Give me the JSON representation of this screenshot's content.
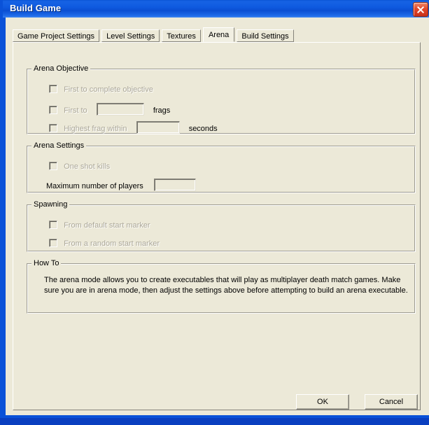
{
  "window": {
    "title": "Build Game",
    "close_icon": "close-icon",
    "accent_color": "#0a52d8",
    "face_color": "#ece9d8"
  },
  "tabs": [
    {
      "label": "Game Project Settings",
      "selected": false
    },
    {
      "label": "Level Settings",
      "selected": false
    },
    {
      "label": "Textures",
      "selected": false
    },
    {
      "label": "Arena",
      "selected": true
    },
    {
      "label": "Build Settings",
      "selected": false
    }
  ],
  "groups": {
    "arena_objective": {
      "title": "Arena Objective",
      "rows": [
        {
          "checkbox_label": "First to complete objective",
          "checked": false,
          "enabled": false
        },
        {
          "checkbox_label": "First to",
          "checked": false,
          "enabled": false,
          "field_value": "",
          "unit_label": "frags"
        },
        {
          "checkbox_label": "Highest frag within",
          "checked": false,
          "enabled": false,
          "field_value": "",
          "unit_label": "seconds"
        }
      ]
    },
    "arena_settings": {
      "title": "Arena Settings",
      "one_shot_kills_label": "One shot kills",
      "one_shot_kills_checked": false,
      "one_shot_kills_enabled": false,
      "max_players_label": "Maximum number of players",
      "max_players_value": ""
    },
    "spawning": {
      "title": "Spawning",
      "rows": [
        {
          "checkbox_label": "From default start marker",
          "checked": false,
          "enabled": false
        },
        {
          "checkbox_label": "From a random start marker",
          "checked": false,
          "enabled": false
        }
      ]
    },
    "how_to": {
      "title": "How To",
      "body": "The arena mode allows you to create executables that will play as multiplayer death match games. Make sure you are in arena mode, then adjust the settings above before attempting to build an arena executable."
    }
  },
  "footer": {
    "ok_label": "OK",
    "cancel_label": "Cancel"
  }
}
